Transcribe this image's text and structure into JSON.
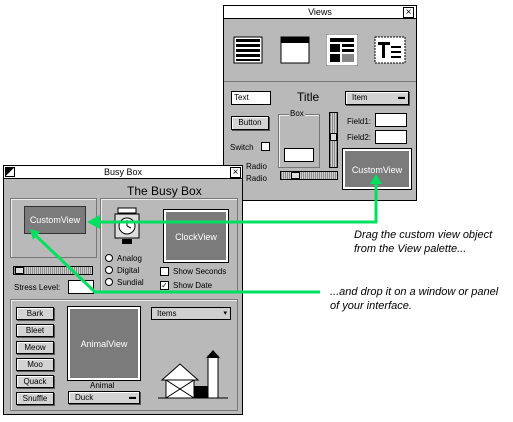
{
  "views_palette": {
    "title": "Views",
    "text_field": "Text",
    "title_label": "Title",
    "popup": "Item",
    "button": "Button",
    "box_label": "Box",
    "field1_label": "Field1:",
    "field2_label": "Field2:",
    "switch_label": "Switch",
    "radio1": "Radio",
    "radio2": "Radio",
    "custom_view": "CustomView"
  },
  "busy_box": {
    "title": "Busy Box",
    "heading": "The Busy Box",
    "custom_view": "CustomView",
    "clock_view": "ClockView",
    "radio_analog": "Analog",
    "radio_digital": "Digital",
    "radio_sundial": "Sundial",
    "show_seconds": "Show Seconds",
    "show_date": "Show Date",
    "stress_label": "Stress Level:",
    "animal_buttons": [
      "Bark",
      "Bleet",
      "Meow",
      "Moo",
      "Quack",
      "Snuffle"
    ],
    "animal_view": "AnimalView",
    "animal_label": "Animal",
    "animal_popup": "Duck",
    "items_popup": "Items"
  },
  "annotations": {
    "drag": "Drag the custom view object from the View palette...",
    "drop": "...and drop it on a window or panel of your interface."
  },
  "colors": {
    "arrow": "#00e060",
    "view_gray": "#7b7b7b",
    "window_bg": "#b9b9b9"
  }
}
